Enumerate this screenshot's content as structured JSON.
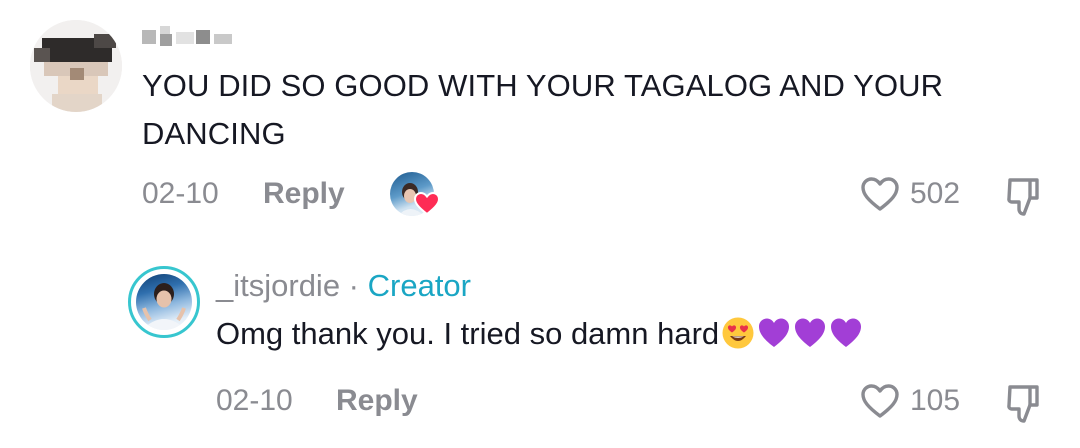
{
  "comment": {
    "text": "YOU DID SO GOOD WITH YOUR TAGALOG AND YOUR DANCING",
    "date": "02-10",
    "reply_label": "Reply",
    "like_count": "502"
  },
  "reply": {
    "username": "_itsjordie",
    "separator": " · ",
    "badge": "Creator",
    "text": "Omg thank you. I tried so damn hard",
    "emojis": [
      "heart-eyes",
      "purple-heart",
      "purple-heart",
      "purple-heart"
    ],
    "date": "02-10",
    "reply_label": "Reply",
    "like_count": "105"
  },
  "colors": {
    "text": "#161823",
    "muted": "#8a8b91",
    "creator": "#1aa6c4",
    "avatar_ring": "#37c6cf",
    "like_badge": "#fe2c55",
    "purple_heart": "#a23ed6"
  },
  "icons": [
    "heart-outline-icon",
    "thumbs-down-icon",
    "creator-liked-badge-icon"
  ]
}
